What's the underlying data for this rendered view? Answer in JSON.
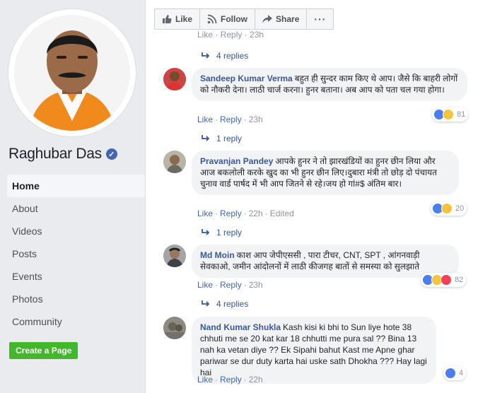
{
  "profile": {
    "name": "Raghubar Das",
    "verified_glyph": "✓"
  },
  "nav": {
    "items": [
      "Home",
      "About",
      "Videos",
      "Posts",
      "Events",
      "Photos",
      "Community"
    ],
    "active": "Home"
  },
  "create_page_label": "Create a Page",
  "action_bar": {
    "like": "Like",
    "follow": "Follow",
    "share": "Share",
    "more": "···"
  },
  "top_cut_meta": "Like · Reply · 23h",
  "comments": [
    {
      "replies_label_before": "4 replies",
      "author": "Sandeep Kumar Verma",
      "text": "बहुत ही सुन्दर काम किए थे आप। जैसे कि बाहरी लोगों को नौकरी देना। लाठी चार्ज करना। हुनर बताना। अब आप को पता चल गया होगा।",
      "like": "Like",
      "reply": "Reply",
      "time": "23h",
      "edited": "",
      "reaction_count": "81",
      "replies_label_after": "1 reply"
    },
    {
      "author": "Pravanjan Pandey",
      "text": "आपके हुनर ने तो झारखंडियों का हुनर छीन लिया और आज बकलोली करके खुद का भी हुनर छीन लिए।दुबारा मंत्री तो छोड़ दो पंचायत चुनाव वार्ड पार्षद में भी आप जितने से रहे।जय हो गां#$ अंतिम बार।",
      "like": "Like",
      "reply": "Reply",
      "time": "22h",
      "edited": "Edited",
      "reaction_count": "20",
      "replies_label_after": "1 reply"
    },
    {
      "author": "Md Moin",
      "text": "काश आप जेपीएससी , पारा टीचर, CNT, SPT , आंगनवाड़ी सेवकाओ, जमीन आंदोलनों में लाठी कीजगह बातों से समस्या को सुलझाते",
      "like": "Like",
      "reply": "Reply",
      "time": "23h",
      "edited": "",
      "reaction_count": "82",
      "replies_label_after": "4 replies"
    },
    {
      "author": "Nand Kumar Shukla",
      "text": "Kash kisi ki bhi to Sun liye hote 38 chhuti me se 20 kat kar 18 chhutti me pura sal ?? Bina 13 nah ka vetan diye ?? Ek Sipahi bahut Kast me Apne ghar pariwar se dur duty karta hai uske sath Dhokha ??? Hay lagi hai",
      "like": "Like",
      "reply": "Reply",
      "time": "22h",
      "edited": "",
      "reaction_count": "4"
    }
  ],
  "colors": {
    "link_blue": "#385898",
    "fb_blue": "#4267b2",
    "green": "#42b72a",
    "page_bg": "#e9ebee"
  }
}
